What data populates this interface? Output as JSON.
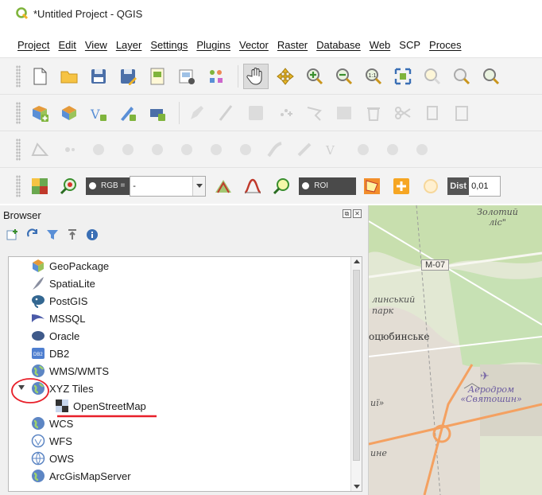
{
  "window": {
    "title": "*Untitled Project - QGIS"
  },
  "menu": [
    {
      "label": "Project"
    },
    {
      "label": "Edit"
    },
    {
      "label": "View"
    },
    {
      "label": "Layer"
    },
    {
      "label": "Settings"
    },
    {
      "label": "Plugins"
    },
    {
      "label": "Vector"
    },
    {
      "label": "Raster"
    },
    {
      "label": "Database"
    },
    {
      "label": "Web"
    },
    {
      "label": "SCP"
    },
    {
      "label": "Proces"
    }
  ],
  "scp_toolbar": {
    "rgb_label": "RGB =",
    "rgb_value": "-",
    "roi_label": "ROI",
    "dist_label": "Dist",
    "dist_value": "0,01"
  },
  "browser": {
    "title": "Browser",
    "items": [
      {
        "label": "GeoPackage",
        "icon": "geopackage-icon"
      },
      {
        "label": "SpatiaLite",
        "icon": "spatialite-icon"
      },
      {
        "label": "PostGIS",
        "icon": "postgis-icon"
      },
      {
        "label": "MSSQL",
        "icon": "mssql-icon"
      },
      {
        "label": "Oracle",
        "icon": "oracle-icon"
      },
      {
        "label": "DB2",
        "icon": "db2-icon"
      },
      {
        "label": "WMS/WMTS",
        "icon": "wms-globe-icon"
      },
      {
        "label": "XYZ Tiles",
        "icon": "xyz-globe-icon",
        "expanded": true
      },
      {
        "label": "OpenStreetMap",
        "icon": "osm-tile-icon",
        "child": true
      },
      {
        "label": "WCS",
        "icon": "wcs-globe-icon"
      },
      {
        "label": "WFS",
        "icon": "wfs-globe-icon"
      },
      {
        "label": "OWS",
        "icon": "ows-globe-icon"
      },
      {
        "label": "ArcGisMapServer",
        "icon": "arcgis-globe-icon"
      }
    ]
  },
  "map": {
    "labels": {
      "forest": "Золотий ліс\"",
      "road": "М-07",
      "park": "линський парк",
      "village": "оцюбинське",
      "airport": "Аеродром «Святошин»",
      "dist1": "иї»",
      "dist2": "ине"
    }
  },
  "colors": {
    "annotation_red": "#e8202a",
    "osm_green": "#dfe6cf",
    "road_orange": "#f4a161"
  }
}
